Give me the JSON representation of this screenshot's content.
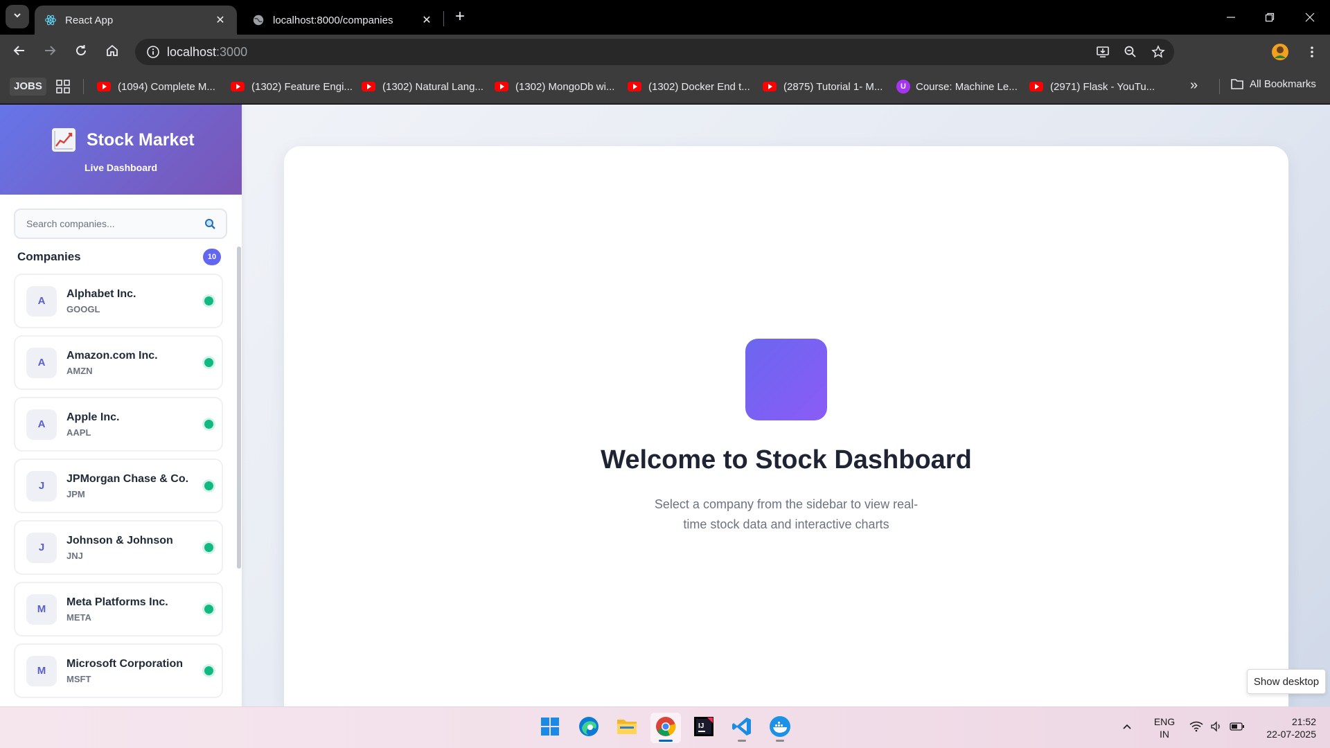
{
  "browser": {
    "tabs": [
      {
        "title": "React App",
        "active": true
      },
      {
        "title": "localhost:8000/companies",
        "active": false
      }
    ],
    "url_host": "localhost",
    "url_port": ":3000",
    "bookmarks": {
      "jobs_label": "JOBS",
      "items": [
        {
          "label": "(1094) Complete M...",
          "icon": "youtube-icon"
        },
        {
          "label": "(1302) Feature Engi...",
          "icon": "youtube-icon"
        },
        {
          "label": "(1302) Natural Lang...",
          "icon": "youtube-icon"
        },
        {
          "label": "(1302) MongoDb wi...",
          "icon": "youtube-icon"
        },
        {
          "label": "(1302) Docker End t...",
          "icon": "youtube-icon"
        },
        {
          "label": "(2875) Tutorial 1- M...",
          "icon": "youtube-icon"
        },
        {
          "label": "Course: Machine Le...",
          "icon": "udemy-icon"
        },
        {
          "label": "(2971) Flask - YouTu...",
          "icon": "youtube-icon"
        }
      ],
      "more_label": "»",
      "all_bookmarks_label": "All Bookmarks"
    }
  },
  "sidebar": {
    "brand_emoji": "📈",
    "brand_title": "Stock Market",
    "brand_subtitle": "Live Dashboard",
    "search_placeholder": "Search companies...",
    "companies_title": "Companies",
    "companies_count": "10",
    "companies": [
      {
        "initial": "A",
        "name": "Alphabet Inc.",
        "ticker": "GOOGL"
      },
      {
        "initial": "A",
        "name": "Amazon.com Inc.",
        "ticker": "AMZN"
      },
      {
        "initial": "A",
        "name": "Apple Inc.",
        "ticker": "AAPL"
      },
      {
        "initial": "J",
        "name": "JPMorgan Chase & Co.",
        "ticker": "JPM"
      },
      {
        "initial": "J",
        "name": "Johnson & Johnson",
        "ticker": "JNJ"
      },
      {
        "initial": "M",
        "name": "Meta Platforms Inc.",
        "ticker": "META"
      },
      {
        "initial": "M",
        "name": "Microsoft Corporation",
        "ticker": "MSFT"
      }
    ],
    "status_color": "#10b981"
  },
  "main": {
    "welcome_title": "Welcome to Stock Dashboard",
    "welcome_text": "Select a company from the sidebar to view real-time stock data and interactive charts"
  },
  "tooltip": {
    "show_desktop": "Show desktop"
  },
  "taskbar": {
    "apps": [
      "start-icon",
      "edge-icon",
      "file-explorer-icon",
      "chrome-icon",
      "intellij-icon",
      "vscode-icon",
      "docker-icon"
    ],
    "lang_line1": "ENG",
    "lang_line2": "IN",
    "time": "21:52",
    "date": "22-07-2025"
  },
  "colors": {
    "accent": "#6366f1",
    "header_gradient_start": "#6675e8",
    "header_gradient_end": "#7a55b6"
  }
}
